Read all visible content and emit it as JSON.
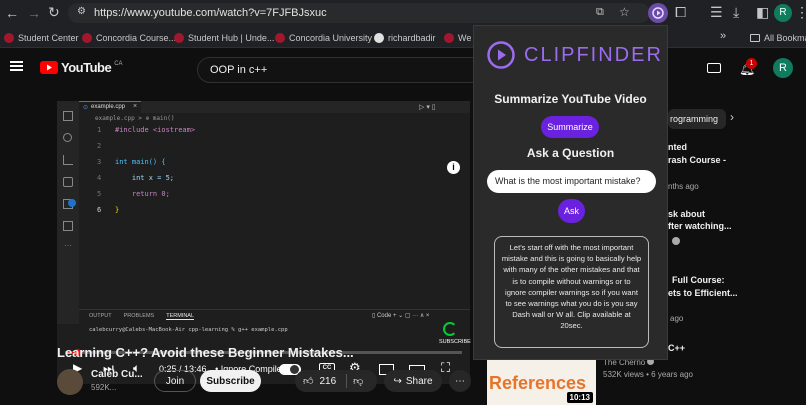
{
  "browser": {
    "url": "https://www.youtube.com/watch?v=7FJFBJsxuc",
    "bookmarks": [
      {
        "label": "Student Center",
        "icon": "concordia-icon"
      },
      {
        "label": "Concordia Course...",
        "icon": "concordia-icon"
      },
      {
        "label": "Student Hub | Unde...",
        "icon": "concordia-icon"
      },
      {
        "label": "Concordia University",
        "icon": "concordia-icon"
      },
      {
        "label": "richardbadir",
        "icon": "github-icon"
      },
      {
        "label": "We",
        "icon": "concordia-icon"
      }
    ],
    "all_bookmarks": "All Bookmar",
    "more": "»"
  },
  "youtube": {
    "logo_text": "YouTube",
    "region": "CA",
    "search_query": "OOP in c++",
    "notification_count": "1",
    "avatar_letter": "R",
    "video": {
      "time": "0:25 / 13:46",
      "chapter": "• Ignore Compiler",
      "title": "Learning C++? Avoid these Beginner Mistakes...",
      "channel": "Caleb Cu...",
      "subs": "592K...",
      "join": "Join",
      "subscribe": "Subscribe",
      "likes": "216",
      "share": "Share",
      "subscribe_overlay": "SUBSCRIBE"
    },
    "editor": {
      "tab": "example.cpp",
      "breadcrumb": "example.cpp > ⊕ main()",
      "lines": [
        "#include <iostream>",
        "",
        "int main() {",
        "    int x = 5;",
        "    return 0;",
        "}"
      ],
      "line_numbers": [
        "1",
        "2",
        "3",
        "4",
        "5",
        "6"
      ],
      "panel_tabs": [
        "OUTPUT",
        "PROBLEMS",
        "TERMINAL"
      ],
      "terminal_line": "calebcurry@Calebs-MacBook-Air cpp-learning % g++ example.cpp",
      "code_label": "Code"
    },
    "sidebar": {
      "chip": "rogramming",
      "items": [
        {
          "line1": "nted",
          "line2": "rash Course -",
          "meta": "nths ago"
        },
        {
          "line1": "sk about",
          "line2": "fter watching...",
          "meta": ""
        },
        {
          "line1": "Full Course:",
          "line2": "ets to Efficient...",
          "meta": "ago"
        },
        {
          "line1": "C++",
          "line2": "",
          "meta": ""
        }
      ],
      "last_channel": "The Cherno",
      "last_meta": "532K views • 6 years ago",
      "thumb_text": "References",
      "thumb_duration": "10:13"
    }
  },
  "extension": {
    "name": "CLIPFINDER",
    "heading_summarize": "Summarize YouTube Video",
    "summarize_btn": "Summarize",
    "heading_ask": "Ask a Question",
    "question_value": "What is the most important mistake?",
    "ask_btn": "Ask",
    "answer": "Let's start off with the most important mistake and this is going to basically help with many of the other mistakes and that is to compile without warnings or to ignore compiler warnings so if you want to see warnings what you do is you say Dash wall or W all. Clip available at 20sec."
  },
  "colors": {
    "accent": "#6a22e0",
    "yt_red": "#ff0000",
    "avatar": "#0f7b5f"
  }
}
